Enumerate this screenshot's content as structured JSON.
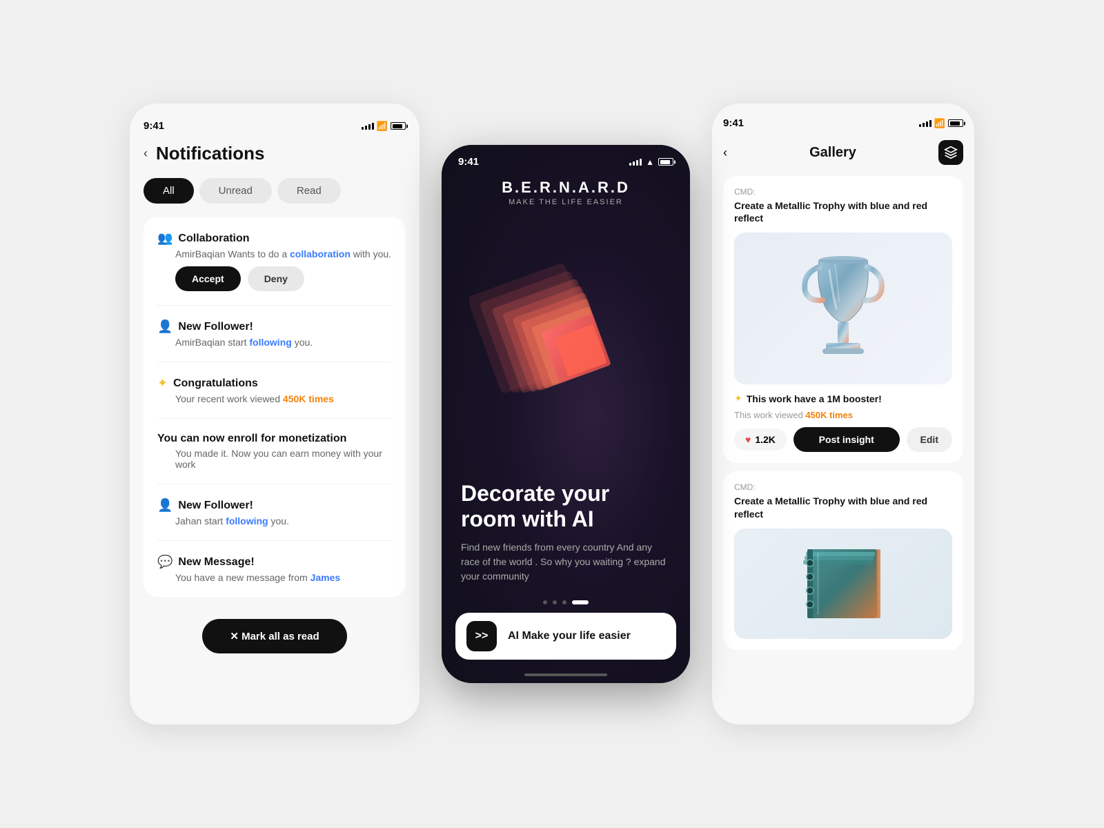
{
  "left_phone": {
    "status_time": "9:41",
    "back_label": "‹",
    "title": "Notifications",
    "tabs": [
      {
        "label": "All",
        "active": true
      },
      {
        "label": "Unread",
        "active": false
      },
      {
        "label": "Read",
        "active": false
      }
    ],
    "notifications": [
      {
        "id": "collab",
        "icon": "👥",
        "icon_color": "orange",
        "title": "Collaboration",
        "desc_prefix": "AmirBaqian Wants to do a ",
        "desc_link": "collaboration",
        "desc_suffix": " with you.",
        "has_actions": true,
        "accept_label": "Accept",
        "deny_label": "Deny"
      },
      {
        "id": "follower1",
        "icon": "👤",
        "icon_color": "blue",
        "title": "New Follower!",
        "desc_prefix": "AmirBaqian start ",
        "desc_link": "following",
        "desc_suffix": " you.",
        "has_actions": false
      },
      {
        "id": "congrats",
        "icon": "✦",
        "icon_color": "gold",
        "title": "Congratulations",
        "desc_prefix": "Your recent work viewed ",
        "desc_link": "450K times",
        "desc_suffix": "",
        "has_actions": false
      },
      {
        "id": "monetize",
        "icon": "",
        "title": "You can now enroll for monetization",
        "desc_prefix": "You made it. Now you can earn money with your work",
        "has_actions": false
      },
      {
        "id": "follower2",
        "icon": "👤",
        "icon_color": "blue",
        "title": "New Follower!",
        "desc_prefix": "Jahan start ",
        "desc_link": "following",
        "desc_suffix": " you.",
        "has_actions": false
      },
      {
        "id": "message",
        "icon": "💬",
        "icon_color": "purple",
        "title": "New Message!",
        "desc_prefix": "You have a new message from ",
        "desc_link": "James",
        "desc_suffix": "",
        "has_actions": false
      }
    ],
    "mark_all_read": "✕  Mark all as read"
  },
  "center_phone": {
    "status_time": "9:41",
    "brand_name": "B.E.R.N.A.R.D",
    "brand_tagline": "MAKE THE LIFE EASIER",
    "headline": "Decorate your room with AI",
    "subtext": "Find new friends from every country And any race of the world . So why you waiting ? expand your community",
    "cta_icon": ">>",
    "cta_text": "AI Make your life easier",
    "dots": [
      1,
      2,
      3,
      4
    ],
    "active_dot": 4
  },
  "right_phone": {
    "status_time": "9:41",
    "back_label": "‹",
    "title": "Gallery",
    "cube_icon": "⬡",
    "card1": {
      "cmd_label": "CMD:",
      "cmd_desc": "Create a Metallic Trophy with blue and red reflect",
      "booster_star": "✦",
      "booster_text": "This work have a 1M booster!",
      "views_prefix": "This work viewed ",
      "views_count": "450K times",
      "like_count": "1.2K",
      "post_insight_label": "Post insight",
      "edit_label": "Edit"
    },
    "card2": {
      "cmd_label": "CMD:",
      "cmd_desc": "Create a Metallic Trophy with blue and red reflect"
    }
  }
}
